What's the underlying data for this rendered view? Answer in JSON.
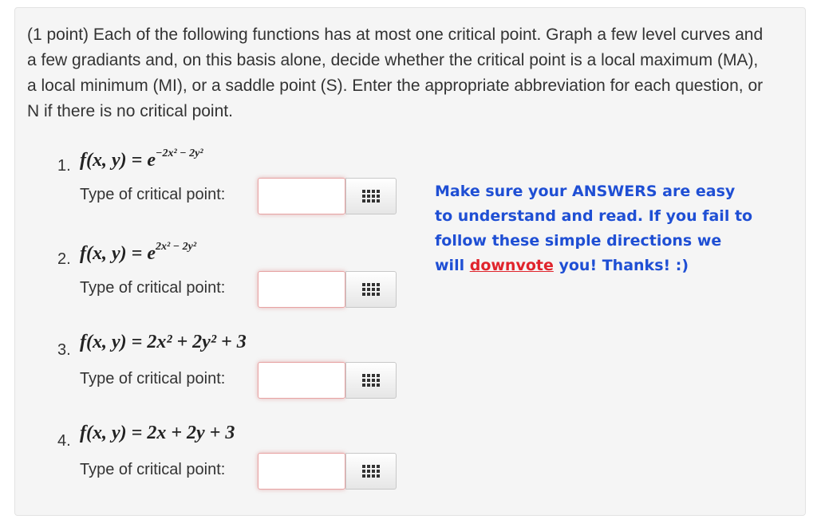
{
  "problem": {
    "intro": "(1 point) Each of the following functions has at most one critical point. Graph a few level curves and a few gradiants and, on this basis alone, decide whether the critical point is a local maximum (MA), a local minimum (MI), or a saddle point (S). Enter the appropriate abbreviation for each question, or N if there is no critical point."
  },
  "questions": [
    {
      "number": "1.",
      "lhs": "f(x, y) = ",
      "rhs": "e",
      "exponent": "−2x² − 2y²",
      "label": "Type of critical point:",
      "value": ""
    },
    {
      "number": "2.",
      "lhs": "f(x, y) = ",
      "rhs": "e",
      "exponent": "2x² − 2y²",
      "label": "Type of critical point:",
      "value": ""
    },
    {
      "number": "3.",
      "lhs": "f(x, y) = ",
      "rhs": "2x² + 2y² + 3",
      "exponent": "",
      "label": "Type of critical point:",
      "value": ""
    },
    {
      "number": "4.",
      "lhs": "f(x, y) = ",
      "rhs": "2x + 2y + 3",
      "exponent": "",
      "label": "Type of critical point:",
      "value": ""
    }
  ],
  "notice": {
    "part1": "Make sure your ANSWERS are easy to understand and read. If you fail to follow these simple directions we will ",
    "link": "downvote",
    "part2": " you! Thanks! :)",
    "color": "#1f4fd4",
    "link_color": "#e0242c"
  },
  "icons": {
    "palette": "grid-palette-icon"
  }
}
